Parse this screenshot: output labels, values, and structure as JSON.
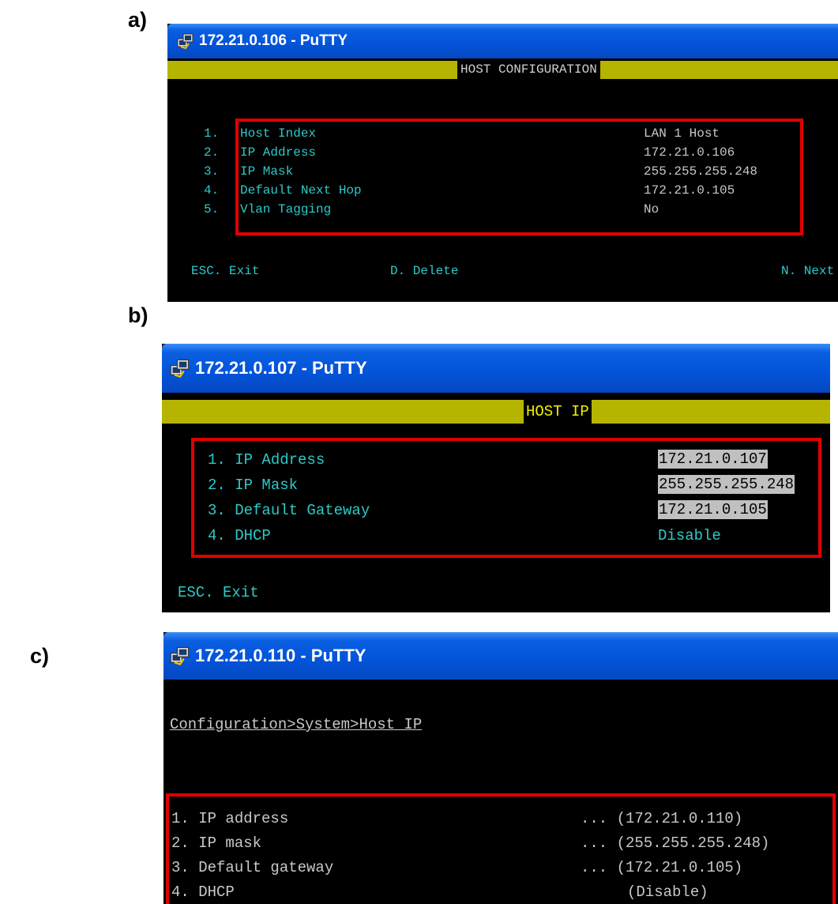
{
  "labels": {
    "a": "a)",
    "b": "b)",
    "c": "c)"
  },
  "panel_a": {
    "title": "172.21.0.106 - PuTTY",
    "banner": "HOST CONFIGURATION",
    "items": [
      {
        "num": "1.",
        "label": "Host Index",
        "value": "LAN 1 Host"
      },
      {
        "num": "2.",
        "label": "IP Address",
        "value": "172.21.0.106"
      },
      {
        "num": "3.",
        "label": "IP Mask",
        "value": "255.255.255.248"
      },
      {
        "num": "4.",
        "label": "Default Next Hop",
        "value": "172.21.0.105"
      },
      {
        "num": "5.",
        "label": "Vlan Tagging",
        "value": "No"
      }
    ],
    "footer": {
      "exit": "ESC. Exit",
      "delete": "D. Delete",
      "next": "N. Next"
    }
  },
  "panel_b": {
    "title": "172.21.0.107 - PuTTY",
    "banner": "HOST IP",
    "items": [
      {
        "label": "1. IP Address",
        "value": "172.21.0.107"
      },
      {
        "label": "2. IP Mask",
        "value": "255.255.255.248"
      },
      {
        "label": "3. Default Gateway",
        "value": "172.21.0.105"
      },
      {
        "label": "4. DHCP",
        "value": "Disable"
      }
    ],
    "footer": {
      "exit": "ESC. Exit"
    }
  },
  "panel_c": {
    "title": "172.21.0.110 - PuTTY",
    "breadcrumb": "Configuration>System>Host IP",
    "items": [
      {
        "label": "1. IP address",
        "value": "... (172.21.0.110)"
      },
      {
        "label": "2. IP mask",
        "value": "... (255.255.255.248)"
      },
      {
        "label": "3. Default gateway",
        "value": "... (172.21.0.105)"
      },
      {
        "label": "4. DHCP",
        "value": "(Disable)"
      }
    ]
  },
  "colors": {
    "titlebar": "#0353d9",
    "banner": "#b5b501",
    "highlight_box": "#e10000",
    "terminal_text_a": "#2ec9c9"
  },
  "icons": [
    "putty-icon"
  ]
}
